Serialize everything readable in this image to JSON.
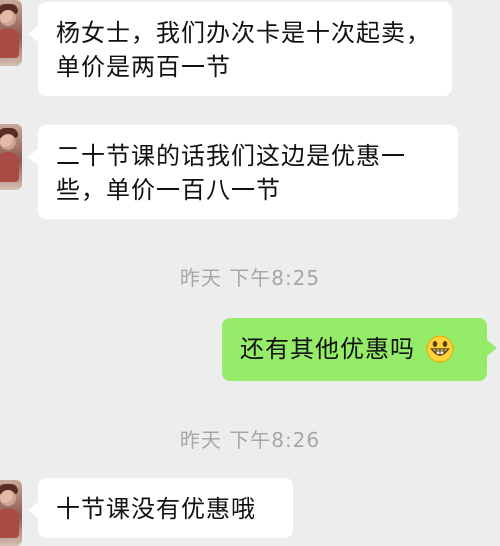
{
  "messages": [
    {
      "text": "杨女士，我们办次卡是十次起卖，单价是两百一节"
    },
    {
      "text": "二十节课的话我们这边是优惠一些，单价一百八一节"
    },
    {
      "timestamp": "昨天 下午8:25"
    },
    {
      "text": "还有其他优惠吗",
      "emoji": "grinning-face-emoji"
    },
    {
      "timestamp": "昨天 下午8:26"
    },
    {
      "text": "十节课没有优惠哦"
    }
  ],
  "colors": {
    "background": "#ededed",
    "received_bubble": "#ffffff",
    "sent_bubble": "#95ec69",
    "timestamp_text": "#a7a7a7"
  }
}
